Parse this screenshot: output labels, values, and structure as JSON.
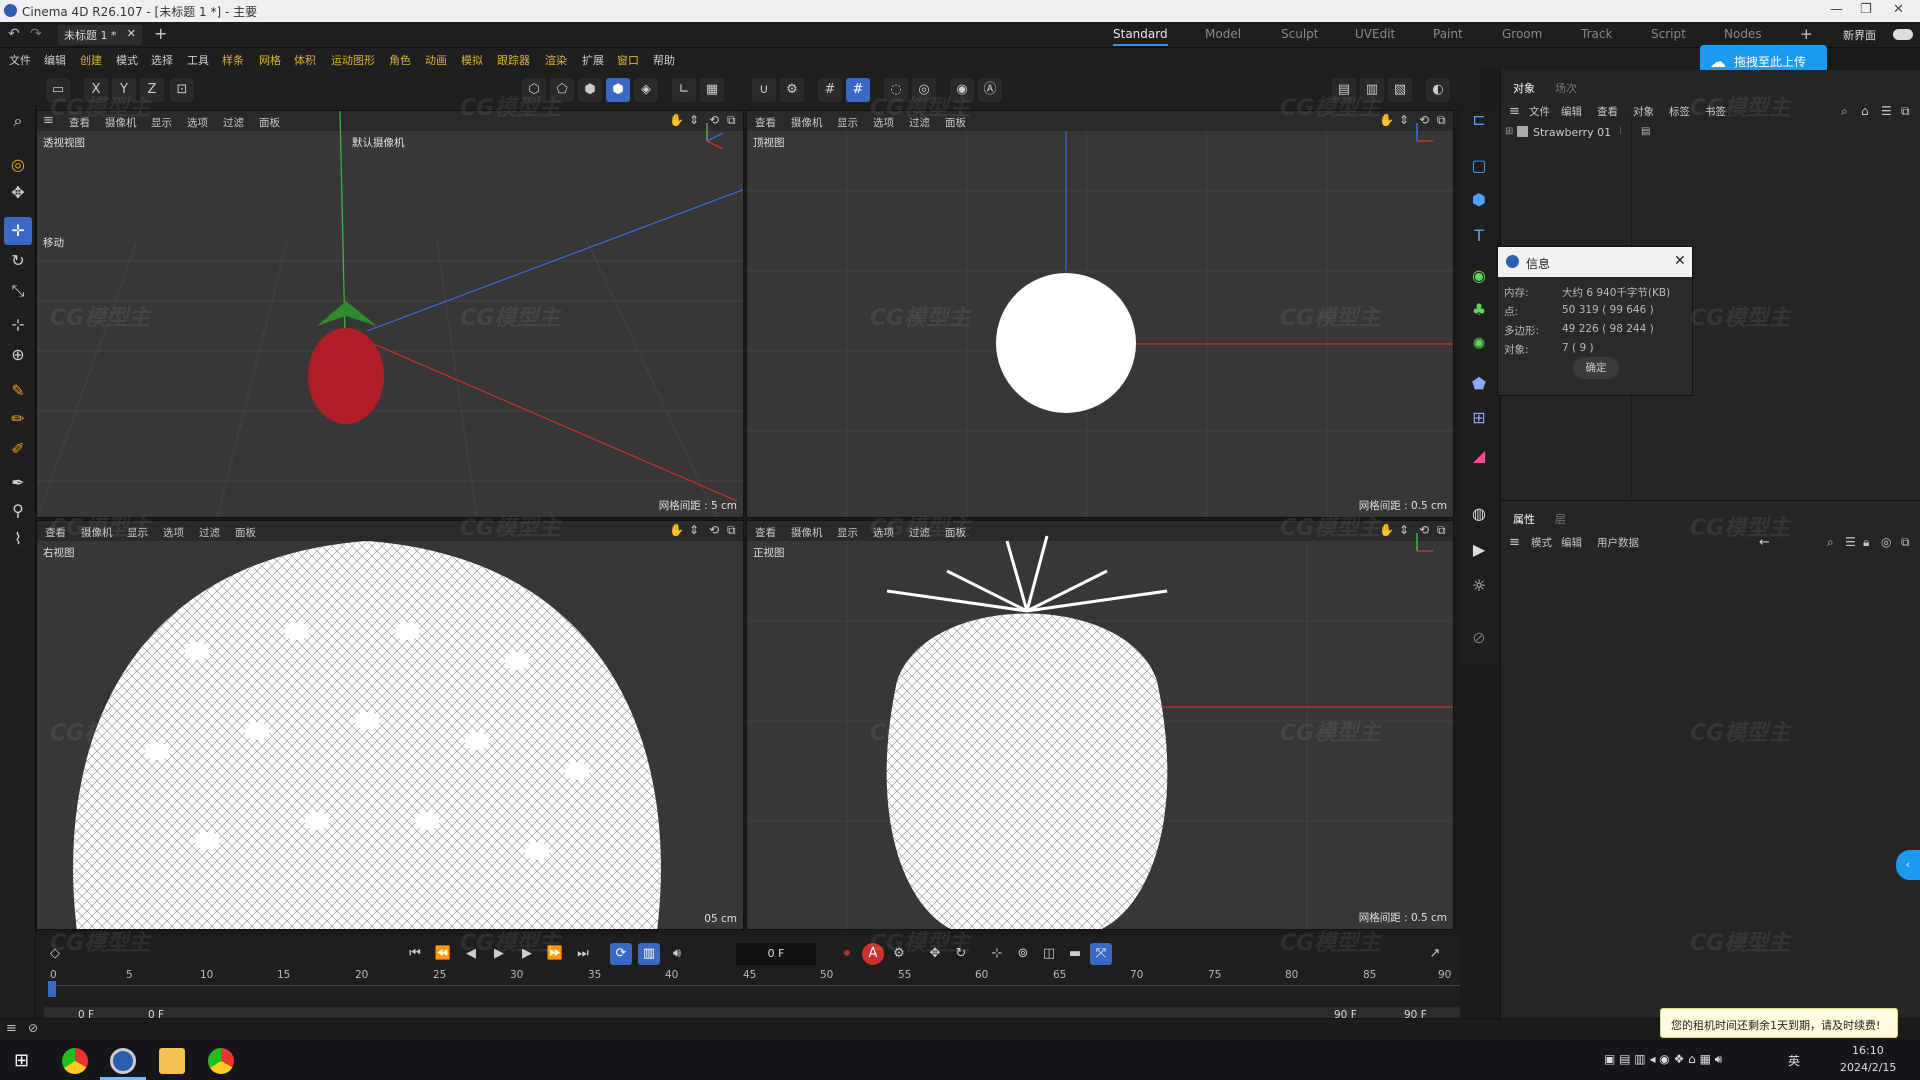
{
  "window": {
    "title": "Cinema 4D R26.107 - [未标题 1 *] - 主要",
    "doc_tab": "未标题 1 *",
    "layouts": [
      "Standard",
      "Model",
      "Sculpt",
      "UVEdit",
      "Paint",
      "Groom",
      "Track",
      "Script",
      "Nodes"
    ],
    "active_layout": "Standard",
    "new_ui_label": "新界面"
  },
  "menu": [
    "文件",
    "编辑",
    "创建",
    "模式",
    "选择",
    "工具",
    "样条",
    "网格",
    "体积",
    "运动图形",
    "角色",
    "动画",
    "模拟",
    "跟踪器",
    "渲染",
    "扩展",
    "窗口",
    "帮助"
  ],
  "toolbar": {
    "axis_labels": [
      "X",
      "Y",
      "Z"
    ]
  },
  "viewport_menu": [
    "查看",
    "摄像机",
    "显示",
    "选项",
    "过滤",
    "面板"
  ],
  "viewports": {
    "perspective": {
      "name": "透视视图",
      "camera": "默认摄像机",
      "grid": "网格间距 : 5 cm",
      "move_label": "移动"
    },
    "top": {
      "name": "顶视图",
      "grid": "网格间距 : 0.5 cm"
    },
    "right": {
      "name": "右视图",
      "grid": "05 cm"
    },
    "front": {
      "name": "正视图",
      "grid": "网格间距 : 0.5 cm"
    }
  },
  "object_manager": {
    "tabs": [
      "对象",
      "场次"
    ],
    "menu": [
      "文件",
      "编辑",
      "查看",
      "对象",
      "标签",
      "书签"
    ],
    "objects": [
      {
        "name": "Strawberry 01"
      }
    ]
  },
  "attribute_manager": {
    "tabs": [
      "属性",
      "层"
    ],
    "menu": [
      "模式",
      "编辑",
      "用户数据"
    ]
  },
  "info_dialog": {
    "title": "信息",
    "rows": [
      {
        "label": "内存:",
        "value": "大约 6 940千字节(KB)"
      },
      {
        "label": "点:",
        "value": "50 319 ( 99 646 )"
      },
      {
        "label": "多边形:",
        "value": "49 226 ( 98 244 )"
      },
      {
        "label": "对象:",
        "value": "7 ( 9 )"
      }
    ],
    "ok_label": "确定"
  },
  "upload_button": "拖拽至此上传",
  "timeline": {
    "current_frame": "0 F",
    "ticks": [
      "0",
      "5",
      "10",
      "15",
      "20",
      "25",
      "30",
      "35",
      "40",
      "45",
      "50",
      "55",
      "60",
      "65",
      "70",
      "75",
      "80",
      "85",
      "90"
    ],
    "start_frame": "0 F",
    "preview_start": "0 F",
    "end_frame": "90 F",
    "preview_end": "90 F"
  },
  "notice": "您的租机时间还剩余1天到期，请及时续费!",
  "watermark": "CG模型主",
  "taskbar": {
    "time": "16:10",
    "date": "2024/2/15",
    "lang": "英"
  },
  "colors": {
    "accent": "#3a68c4",
    "upload": "#1a9bf0",
    "strawberry": "#b01e28"
  }
}
